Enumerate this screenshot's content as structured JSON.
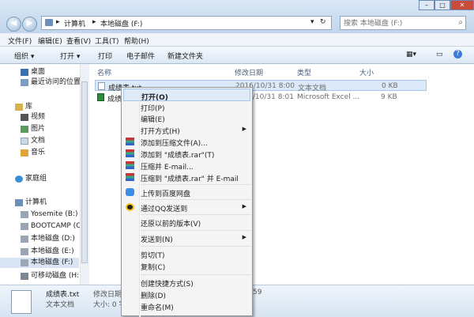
{
  "address": {
    "root_icon": "computer-icon",
    "seg1": "计算机",
    "seg2": "本地磁盘 (F:)",
    "sep": "▸"
  },
  "search": {
    "placeholder": "搜索 本地磁盘 (F:)"
  },
  "menu": {
    "file": "文件(F)",
    "edit": "编辑(E)",
    "view": "查看(V)",
    "tools": "工具(T)",
    "help": "帮助(H)"
  },
  "toolbar": {
    "organize": "组织 ▾",
    "open": "打开 ▾",
    "print": "打印",
    "email": "电子邮件",
    "new_folder": "新建文件夹"
  },
  "nav": {
    "desktop": "桌面",
    "recent": "最近访问的位置",
    "library": "库",
    "video": "视频",
    "pictures": "图片",
    "docs": "文档",
    "music": "音乐",
    "homegroup": "家庭组",
    "computer": "计算机",
    "drive_b": "Yosemite (B:)",
    "drive_c": "BOOTCAMP (C:)",
    "drive_d": "本地磁盘 (D:)",
    "drive_e": "本地磁盘 (E:)",
    "drive_f": "本地磁盘 (F:)",
    "drive_h": "可移动磁盘 (H:)"
  },
  "columns": {
    "name": "名称",
    "date": "修改日期",
    "type": "类型",
    "size": "大小"
  },
  "files": [
    {
      "name": "成绩表.txt",
      "date": "2016/10/31 8:00",
      "type": "文本文档",
      "size": "0 KB"
    },
    {
      "name": "成绩",
      "date": "2016/10/31 8:01",
      "type": "Microsoft Excel ...",
      "size": "9 KB"
    }
  ],
  "details": {
    "name": "成绩表.txt",
    "type": "文本文档",
    "modified_label": "修改日期: 2016",
    "size_label": "大小: 0 字",
    "modified_tail": "59"
  },
  "context_menu": {
    "open": "打开(O)",
    "print": "打印(P)",
    "edit": "编辑(E)",
    "open_with": "打开方式(H)",
    "add_archive": "添加到压缩文件(A)...",
    "add_rar": "添加到 \"成绩表.rar\"(T)",
    "compress_email": "压缩并 E-mail...",
    "compress_rar_email": "压缩到 \"成绩表.rar\" 并 E-mail",
    "upload_baidu": "上传到百度网盘",
    "send_qq": "通过QQ发送到",
    "restore": "还原以前的版本(V)",
    "send_to": "发送到(N)",
    "cut": "剪切(T)",
    "copy": "复制(C)",
    "shortcut": "创建快捷方式(S)",
    "delete": "删除(D)",
    "rename": "重命名(M)"
  },
  "colors": {
    "accent": "#3399ff",
    "selection": "#dbe9f8",
    "menu_bg": "#f4f4f4"
  }
}
